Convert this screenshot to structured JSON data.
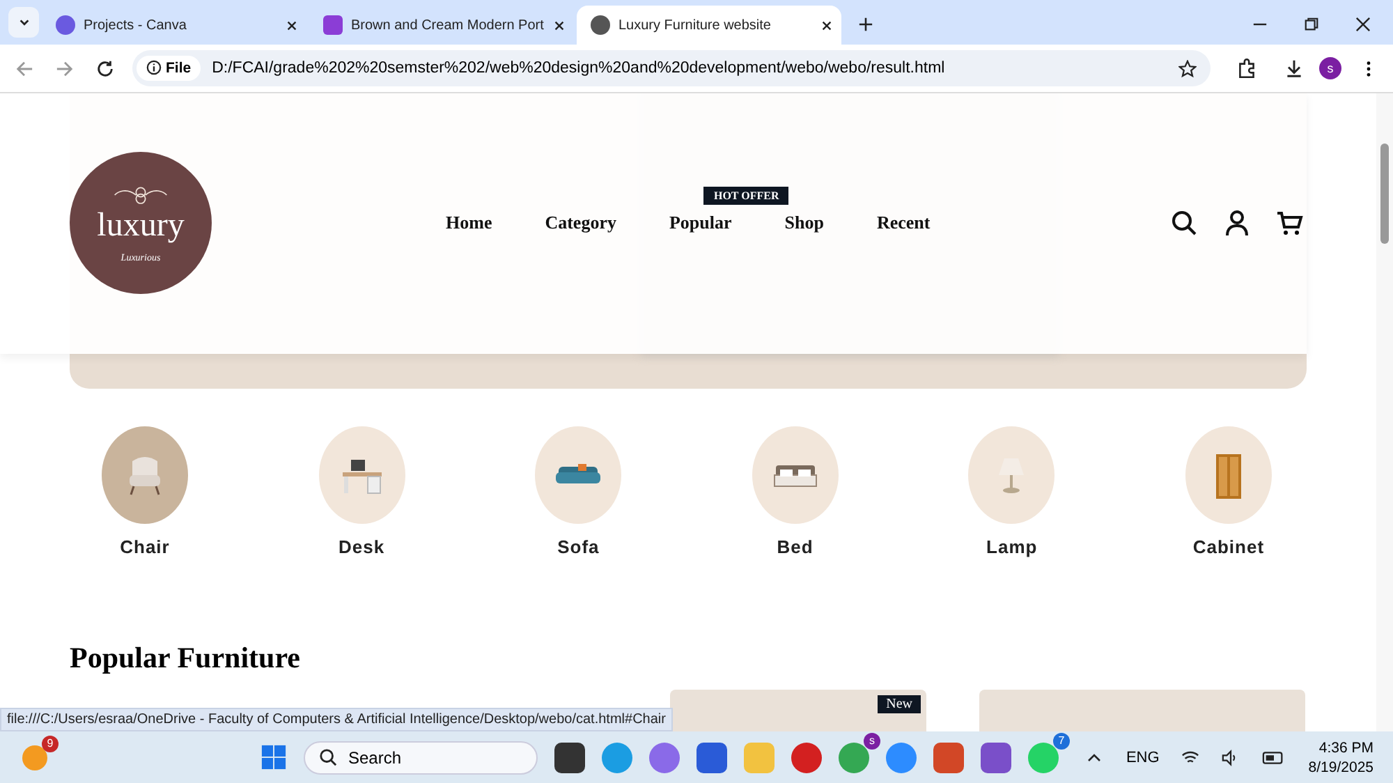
{
  "browser": {
    "tabs": [
      {
        "title": "Projects - Canva",
        "selected": false
      },
      {
        "title": "Brown and Cream Modern Port",
        "selected": false
      },
      {
        "title": "Luxury Furniture website",
        "selected": true
      }
    ],
    "address": {
      "scheme": "File",
      "url": "D:/FCAI/grade%202%20semster%202/web%20design%20and%20development/webo/webo/result.html"
    },
    "profile": "s"
  },
  "header": {
    "logo": {
      "name": "luxury",
      "tagline": "Luxurious"
    },
    "nav": [
      {
        "label": "Home"
      },
      {
        "label": "Category"
      },
      {
        "label": "Popular",
        "badge": "HOT OFFER"
      },
      {
        "label": "Shop"
      },
      {
        "label": "Recent"
      }
    ]
  },
  "categories": [
    {
      "label": "Chair",
      "kind": "chair",
      "selected": true
    },
    {
      "label": "Desk",
      "kind": "desk",
      "selected": false
    },
    {
      "label": "Sofa",
      "kind": "sofa",
      "selected": false
    },
    {
      "label": "Bed",
      "kind": "bed",
      "selected": false
    },
    {
      "label": "Lamp",
      "kind": "lamp",
      "selected": false
    },
    {
      "label": "Cabinet",
      "kind": "cabinet",
      "selected": false
    }
  ],
  "popular": {
    "title": "Popular Furniture",
    "new_label": "New",
    "cards": [
      {
        "new": true
      },
      {
        "new": false
      }
    ]
  },
  "status_link": "file:///C:/Users/esraa/OneDrive - Faculty of Computers & Artificial Intelligence/Desktop/webo/cat.html#Chair",
  "taskbar": {
    "widget_badge": "9",
    "search": "Search",
    "chrome_badge": "s",
    "whatsapp_badge": "7",
    "language": "ENG",
    "time": "4:36 PM",
    "date": "8/19/2025"
  }
}
